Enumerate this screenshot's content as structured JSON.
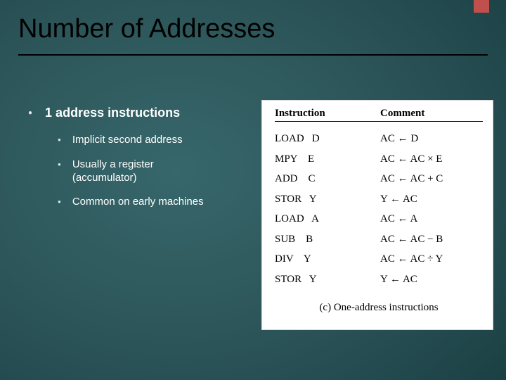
{
  "title": "Number of Addresses",
  "bullets": {
    "main": "1 address instructions",
    "subs": [
      "Implicit second address",
      "Usually a register (accumulator)",
      "Common on early machines"
    ]
  },
  "figure": {
    "head_instruction": "Instruction",
    "head_comment": "Comment",
    "rows": [
      {
        "instr": "LOAD   D",
        "comment": "AC ← D"
      },
      {
        "instr": "MPY    E",
        "comment": "AC ← AC × E"
      },
      {
        "instr": "ADD    C",
        "comment": "AC ← AC + C"
      },
      {
        "instr": "STOR   Y",
        "comment": "Y ← AC"
      },
      {
        "instr": "LOAD   A",
        "comment": "AC ← A"
      },
      {
        "instr": "SUB    B",
        "comment": "AC ← AC − B"
      },
      {
        "instr": "DIV    Y",
        "comment": "AC ← AC ÷ Y"
      },
      {
        "instr": "STOR   Y",
        "comment": "Y ← AC"
      }
    ],
    "caption": "(c) One-address instructions"
  }
}
